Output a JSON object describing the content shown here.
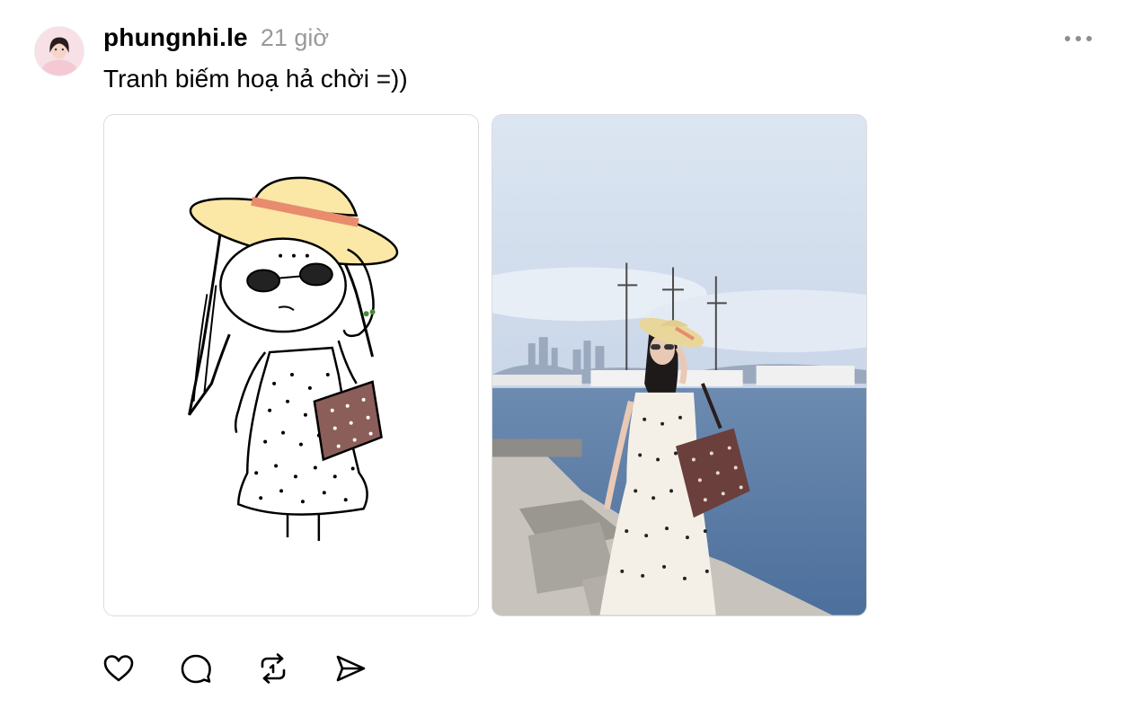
{
  "post": {
    "username": "phungnhi.le",
    "timestamp": "21 giờ",
    "caption": "Tranh biếm hoạ hả chời =))",
    "avatar_icon": "profile-photo",
    "more_icon": "more-horizontal-icon"
  },
  "media": [
    {
      "kind": "illustration",
      "description_icon": "cartoon-drawing-image"
    },
    {
      "kind": "photo",
      "description_icon": "harbor-photo-image"
    }
  ],
  "actions": [
    {
      "name": "like",
      "icon": "heart-icon"
    },
    {
      "name": "comment",
      "icon": "comment-icon"
    },
    {
      "name": "repost",
      "icon": "repost-icon"
    },
    {
      "name": "share",
      "icon": "send-icon"
    }
  ],
  "colors": {
    "text_primary": "#000000",
    "text_secondary": "#999999",
    "icon": "#000000",
    "more_dots": "#8e8e8e"
  }
}
